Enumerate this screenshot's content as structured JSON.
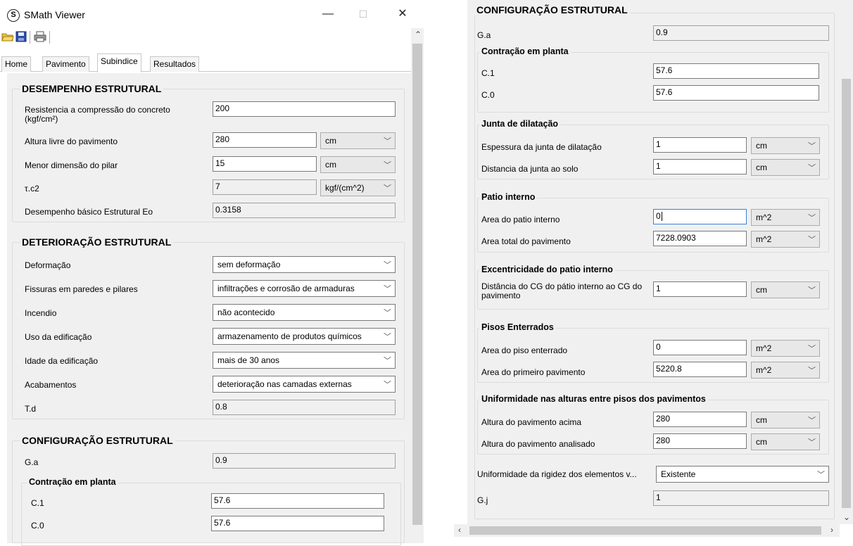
{
  "window": {
    "title": "SMath Viewer",
    "logo_letter": "S",
    "minimize": "—",
    "maximize": "☐",
    "close": "✕"
  },
  "tabs": [
    "Home",
    "Pavimento",
    "Subindice",
    "Resultados"
  ],
  "active_tab": "Subindice",
  "left": {
    "desempenho": {
      "title": "DESEMPENHO ESTRUTURAL",
      "resistencia_label": "Resistencia a compressão do concreto (kgf/cm²)",
      "resistencia_value": "200",
      "altura_label": "Altura livre do pavimento",
      "altura_value": "280",
      "altura_unit": "cm",
      "menor_label": "Menor dimensão do pilar",
      "menor_value": "15",
      "menor_unit": "cm",
      "tc2_label": "τ.c2",
      "tc2_value": "7",
      "tc2_unit": "kgf/(cm^2)",
      "eo_label": "Desempenho básico Estrutural Eo",
      "eo_value": "0.3158"
    },
    "deterioracao": {
      "title": "DETERIORAÇÃO ESTRUTURAL",
      "deformacao_label": "Deformação",
      "deformacao_value": "sem deformação",
      "fissuras_label": "Fissuras em paredes e pilares",
      "fissuras_value": "infiltrações e corrosão de armaduras",
      "incendio_label": "Incendio",
      "incendio_value": "não acontecido",
      "uso_label": "Uso da edificação",
      "uso_value": "armazenamento de produtos químicos",
      "idade_label": "Idade da edificação",
      "idade_value": "mais de 30 anos",
      "acabamentos_label": "Acabamentos",
      "acabamentos_value": "deterioração nas camadas externas",
      "td_label": "T.d",
      "td_value": "0.8"
    },
    "configuracao": {
      "title": "CONFIGURAÇÃO ESTRUTURAL",
      "ga_label": "G.a",
      "ga_value": "0.9",
      "contracao_title": "Contração em planta",
      "c1_label": "C.1",
      "c1_value": "57.6",
      "c0_label": "C.0",
      "c0_value": "57.6"
    }
  },
  "right": {
    "configuracao_title": "CONFIGURAÇÃO ESTRUTURAL",
    "ga_label": "G.a",
    "ga_value": "0.9",
    "contracao": {
      "title": "Contração em planta",
      "c1_label": "C.1",
      "c1_value": "57.6",
      "c0_label": "C.0",
      "c0_value": "57.6"
    },
    "junta": {
      "title": "Junta de dilatação",
      "espessura_label": "Espessura da junta de dilatação",
      "espessura_value": "1",
      "espessura_unit": "cm",
      "distancia_label": "Distancia da junta ao solo",
      "distancia_value": "1",
      "distancia_unit": "cm"
    },
    "patio": {
      "title": "Patio interno",
      "area_patio_label": "Area do patio interno",
      "area_patio_value": "0",
      "area_patio_unit": "m^2",
      "area_total_label": "Area total do pavimento",
      "area_total_value": "7228.0903",
      "area_total_unit": "m^2"
    },
    "excentricidade": {
      "title": "Excentricidade do patio interno",
      "distancia_label": "Distância do CG do pátio interno ao CG do pavimento",
      "distancia_value": "1",
      "distancia_unit": "cm"
    },
    "pisos": {
      "title": "Pisos Enterrados",
      "area_piso_label": "Area do piso enterrado",
      "area_piso_value": "0",
      "area_piso_unit": "m^2",
      "area_primeiro_label": "Area do primeiro pavimento",
      "area_primeiro_value": "5220.8",
      "area_primeiro_unit": "m^2"
    },
    "uniformidade": {
      "title": "Uniformidade nas alturas entre pisos dos pavimentos",
      "acima_label": "Altura do pavimento acima",
      "acima_value": "280",
      "acima_unit": "cm",
      "analisado_label": "Altura do pavimento analisado",
      "analisado_value": "280",
      "analisado_unit": "cm"
    },
    "rigidez_label": "Uniformidade da rigidez dos elementos v...",
    "rigidez_value": "Existente",
    "gj_label": "G.j",
    "gj_value": "1"
  }
}
